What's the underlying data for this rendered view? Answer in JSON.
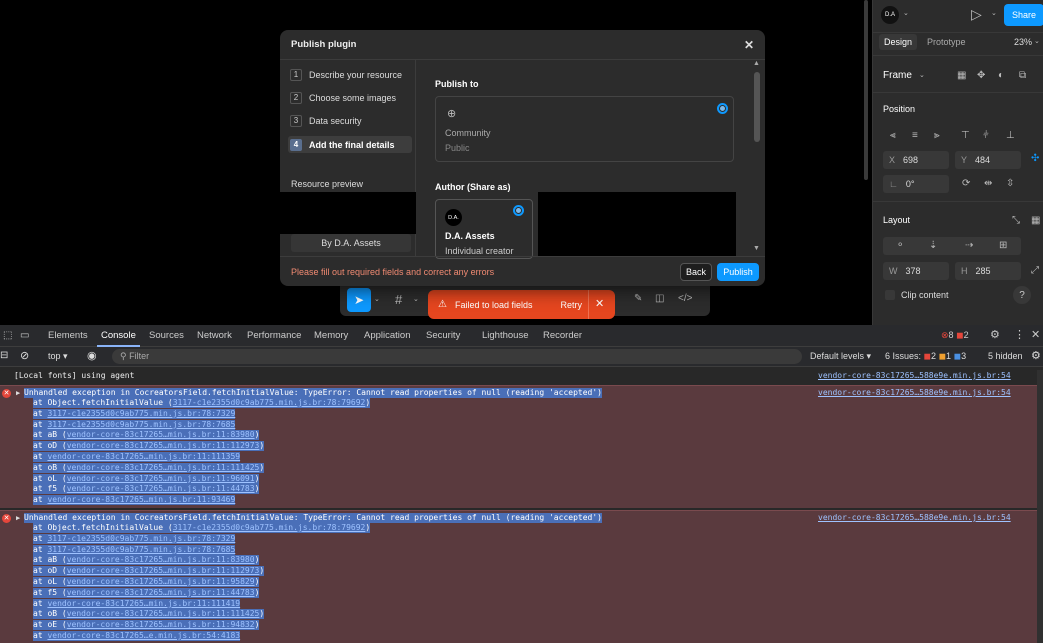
{
  "right_panel": {
    "avatar": "D.A",
    "share_label": "Share",
    "tabs": [
      "Design",
      "Prototype"
    ],
    "zoom": "23%",
    "frame_label": "Frame",
    "position_label": "Position",
    "x_label": "X",
    "x_value": "698",
    "y_label": "Y",
    "y_value": "484",
    "rotation_value": "0°",
    "layout_label": "Layout",
    "w_label": "W",
    "w_value": "378",
    "h_label": "H",
    "h_value": "285",
    "clip_label": "Clip content"
  },
  "modal": {
    "title": "Publish plugin",
    "steps": [
      {
        "num": "1",
        "label": "Describe your resource"
      },
      {
        "num": "2",
        "label": "Choose some images"
      },
      {
        "num": "3",
        "label": "Data security"
      },
      {
        "num": "4",
        "label": "Add the final details"
      }
    ],
    "resource_preview_label": "Resource preview",
    "preview_by": "By D.A. Assets",
    "publish_to_label": "Publish to",
    "community_title": "Community",
    "community_sub": "Public",
    "author_label": "Author (Share as)",
    "author_avatar": "D.A.",
    "author_name": "D.A. Assets",
    "author_role": "Individual creator",
    "error_msg": "Please fill out required fields and correct any errors",
    "back_label": "Back",
    "publish_label": "Publish"
  },
  "toast": {
    "message": "Failed to load fields",
    "retry_label": "Retry"
  },
  "devtools": {
    "tabs": [
      "Elements",
      "Console",
      "Sources",
      "Network",
      "Performance",
      "Memory",
      "Application",
      "Security",
      "Lighthouse",
      "Recorder"
    ],
    "error_count": "8",
    "warn_count": "2",
    "context": "top",
    "filter_placeholder": "Filter",
    "levels": "Default levels",
    "issues_label": "6 Issues:",
    "issues_err": "2",
    "issues_warn": "1",
    "issues_info": "3",
    "hidden": "5 hidden",
    "info_line": "[Local fonts] using agent",
    "info_src": "vendor-core-83c17265…588e9e.min.js.br:54",
    "block1": {
      "src": "vendor-core-83c17265…588e9e.min.js.br:54",
      "message": "Unhandled exception in CocreatorsField.fetchInitialValue: TypeError: Cannot read properties of null (reading 'accepted')",
      "frames": [
        {
          "pre": "at Object.fetchInitialValue (",
          "link": "3117-c1e2355d0c9ab775.min.js.br:78:79692",
          "post": ")"
        },
        {
          "pre": "at ",
          "link": "3117-c1e2355d0c9ab775.min.js.br:78:7329",
          "post": ""
        },
        {
          "pre": "at ",
          "link": "3117-c1e2355d0c9ab775.min.js.br:78:7685",
          "post": ""
        },
        {
          "pre": "at aB (",
          "link": "vendor-core-83c17265…min.js.br:11:83980",
          "post": ")"
        },
        {
          "pre": "at oD (",
          "link": "vendor-core-83c17265…min.js.br:11:112973",
          "post": ")"
        },
        {
          "pre": "at ",
          "link": "vendor-core-83c17265…min.js.br:11:111359",
          "post": ""
        },
        {
          "pre": "at oB (",
          "link": "vendor-core-83c17265…min.js.br:11:111425",
          "post": ")"
        },
        {
          "pre": "at oL (",
          "link": "vendor-core-83c17265…min.js.br:11:96091",
          "post": ")"
        },
        {
          "pre": "at f5 (",
          "link": "vendor-core-83c17265…min.js.br:11:44783",
          "post": ")"
        },
        {
          "pre": "at ",
          "link": "vendor-core-83c17265…min.js.br:11:93469",
          "post": ""
        }
      ]
    },
    "block2": {
      "src": "vendor-core-83c17265…588e9e.min.js.br:54",
      "message": "Unhandled exception in CocreatorsField.fetchInitialValue: TypeError: Cannot read properties of null (reading 'accepted')",
      "frames": [
        {
          "pre": "at Object.fetchInitialValue (",
          "link": "3117-c1e2355d0c9ab775.min.js.br:78:79692",
          "post": ")"
        },
        {
          "pre": "at ",
          "link": "3117-c1e2355d0c9ab775.min.js.br:78:7329",
          "post": ""
        },
        {
          "pre": "at ",
          "link": "3117-c1e2355d0c9ab775.min.js.br:78:7685",
          "post": ""
        },
        {
          "pre": "at aB (",
          "link": "vendor-core-83c17265…min.js.br:11:83980",
          "post": ")"
        },
        {
          "pre": "at oD (",
          "link": "vendor-core-83c17265…min.js.br:11:112973",
          "post": ")"
        },
        {
          "pre": "at oL (",
          "link": "vendor-core-83c17265…min.js.br:11:95829",
          "post": ")"
        },
        {
          "pre": "at f5 (",
          "link": "vendor-core-83c17265…min.js.br:11:44783",
          "post": ")"
        },
        {
          "pre": "at ",
          "link": "vendor-core-83c17265…min.js.br:11:111419",
          "post": ""
        },
        {
          "pre": "at oB (",
          "link": "vendor-core-83c17265…min.js.br:11:111425",
          "post": ")"
        },
        {
          "pre": "at oE (",
          "link": "vendor-core-83c17265…min.js.br:11:94832",
          "post": ")"
        },
        {
          "pre": "at ",
          "link": "vendor-core-83c17265…e.min.js.br:54:4183",
          "post": ""
        }
      ]
    }
  }
}
